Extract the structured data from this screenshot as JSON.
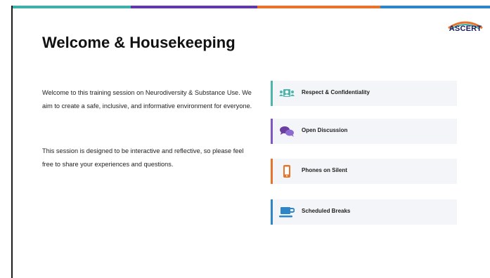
{
  "colors": {
    "accent_teal": "#4db6ac",
    "accent_purple": "#7e57c2",
    "accent_orange": "#e8732a",
    "accent_blue": "#2e86c9",
    "card_background": "#f3f5f8"
  },
  "top_bar": [
    "#3fb0a8",
    "#5e3aa8",
    "#e8732a",
    "#2e86c9"
  ],
  "logo": {
    "text": "ASCERT"
  },
  "slide": {
    "title": "Welcome & Housekeeping",
    "paragraphs": [
      "Welcome to this training session on Neurodiversity & Substance Use. We aim to create a safe, inclusive, and informative environment for everyone.",
      "This session is designed to be interactive and reflective, so please feel free to share your experiences and questions."
    ]
  },
  "cards": [
    {
      "label": "Respect & Confidentiality",
      "icon": "people-group-icon",
      "color": "#4db6ac"
    },
    {
      "label": "Open Discussion",
      "icon": "chat-bubbles-icon",
      "color": "#7e57c2"
    },
    {
      "label": "Phones on Silent",
      "icon": "mobile-phone-icon",
      "color": "#e8732a"
    },
    {
      "label": "Scheduled Breaks",
      "icon": "coffee-cup-icon",
      "color": "#2e86c9"
    }
  ]
}
